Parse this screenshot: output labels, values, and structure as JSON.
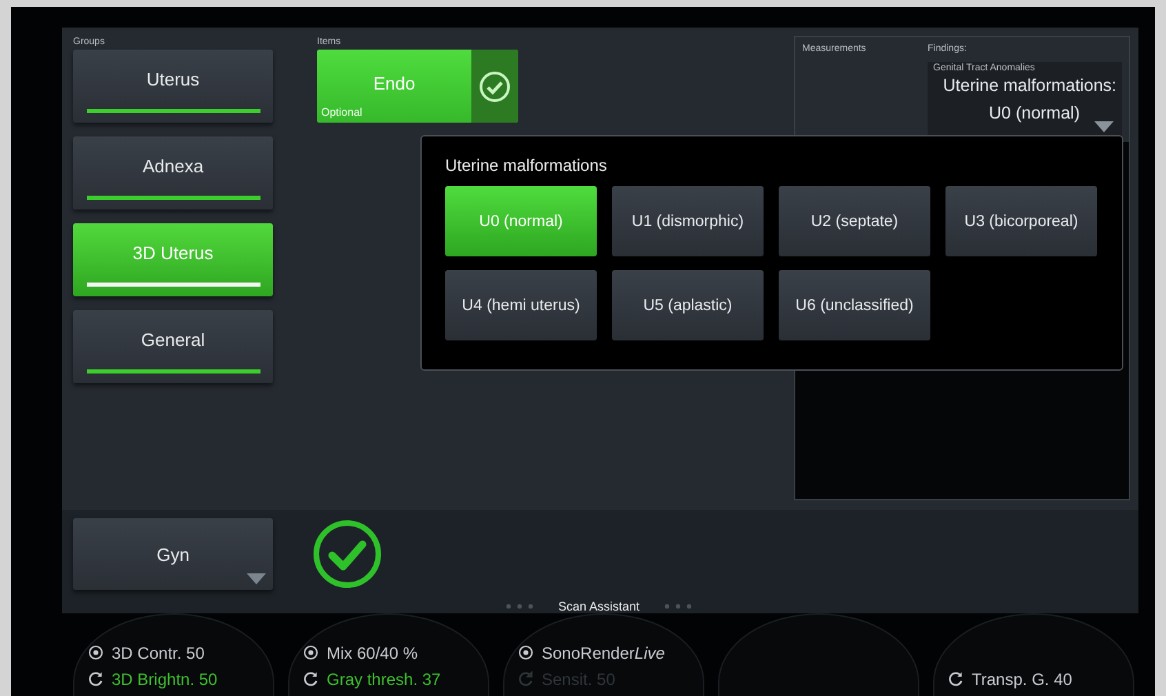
{
  "groups": {
    "label": "Groups",
    "items": [
      {
        "label": "Uterus",
        "selected": false
      },
      {
        "label": "Adnexa",
        "selected": false
      },
      {
        "label": "3D Uterus",
        "selected": true
      },
      {
        "label": "General",
        "selected": false
      }
    ]
  },
  "items": {
    "label": "Items",
    "items": [
      {
        "label": "Endo",
        "sublabel": "Optional",
        "checked": true
      }
    ]
  },
  "measurements": {
    "label": "Measurements"
  },
  "findings": {
    "label": "Findings:",
    "category": "Genital Tract Anomalies",
    "title": "Uterine malformations:",
    "value": "U0 (normal)"
  },
  "popup": {
    "title": "Uterine malformations",
    "options": [
      {
        "label": "U0 (normal)",
        "selected": true
      },
      {
        "label": "U1 (dismorphic)",
        "selected": false
      },
      {
        "label": "U2 (septate)",
        "selected": false
      },
      {
        "label": "U3 (bicorporeal)",
        "selected": false
      },
      {
        "label": "U4 (hemi uterus)",
        "selected": false
      },
      {
        "label": "U5 (aplastic)",
        "selected": false
      },
      {
        "label": "U6 (unclassified)",
        "selected": false
      }
    ]
  },
  "footer": {
    "preset": "Gyn",
    "confirmed": true,
    "assistant_label": "Scan Assistant"
  },
  "knobs": [
    {
      "kind": "control",
      "controls": [
        {
          "kind": "push",
          "label": "3D Contr. 50",
          "active": false,
          "disabled": false
        },
        {
          "kind": "rotate",
          "label": "3D Brightn. 50",
          "active": true,
          "disabled": false
        }
      ]
    },
    {
      "kind": "control",
      "controls": [
        {
          "kind": "push",
          "label": "Mix 60/40 %",
          "active": false,
          "disabled": false
        },
        {
          "kind": "rotate",
          "label": "Gray thresh. 37",
          "active": true,
          "disabled": false
        }
      ]
    },
    {
      "kind": "control",
      "controls": [
        {
          "kind": "push",
          "label": "SonoRender",
          "label_italic": "Live",
          "active": false,
          "disabled": false
        },
        {
          "kind": "rotate",
          "label": "Sensit. 50",
          "active": false,
          "disabled": true
        }
      ]
    },
    {
      "kind": "blank"
    },
    {
      "kind": "control",
      "controls": [
        {
          "kind": "rotate",
          "label": "Transp. G. 40",
          "active": false,
          "disabled": false
        }
      ]
    }
  ]
}
